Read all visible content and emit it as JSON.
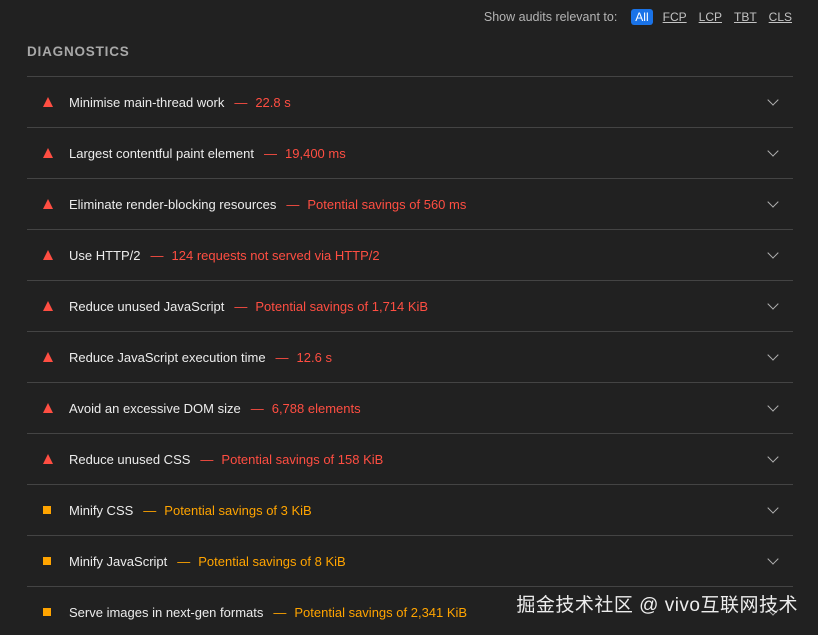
{
  "filter": {
    "label": "Show audits relevant to:",
    "buttons": [
      "All",
      "FCP",
      "LCP",
      "TBT",
      "CLS"
    ],
    "active": "All"
  },
  "section_title": "DIAGNOSTICS",
  "audits": [
    {
      "status": "fail",
      "title": "Minimise main-thread work",
      "value": "22.8 s"
    },
    {
      "status": "fail",
      "title": "Largest contentful paint element",
      "value": "19,400 ms"
    },
    {
      "status": "fail",
      "title": "Eliminate render-blocking resources",
      "value": "Potential savings of 560 ms"
    },
    {
      "status": "fail",
      "title": "Use HTTP/2",
      "value": "124 requests not served via HTTP/2"
    },
    {
      "status": "fail",
      "title": "Reduce unused JavaScript",
      "value": "Potential savings of 1,714 KiB"
    },
    {
      "status": "fail",
      "title": "Reduce JavaScript execution time",
      "value": "12.6 s"
    },
    {
      "status": "fail",
      "title": "Avoid an excessive DOM size",
      "value": "6,788 elements"
    },
    {
      "status": "fail",
      "title": "Reduce unused CSS",
      "value": "Potential savings of 158 KiB"
    },
    {
      "status": "average",
      "title": "Minify CSS",
      "value": "Potential savings of 3 KiB"
    },
    {
      "status": "average",
      "title": "Minify JavaScript",
      "value": "Potential savings of 8 KiB"
    },
    {
      "status": "average",
      "title": "Serve images in next-gen formats",
      "value": "Potential savings of 2,341 KiB"
    }
  ],
  "separator": "—",
  "icons": {
    "fail": "warning-triangle-icon",
    "average": "average-square-icon",
    "expand": "chevron-down-icon"
  },
  "colors": {
    "fail": "#ff4e42",
    "average": "#ffa400",
    "active_filter": "#1a73e8",
    "background": "#212121"
  },
  "watermark": "掘金技术社区 @ vivo互联网技术"
}
